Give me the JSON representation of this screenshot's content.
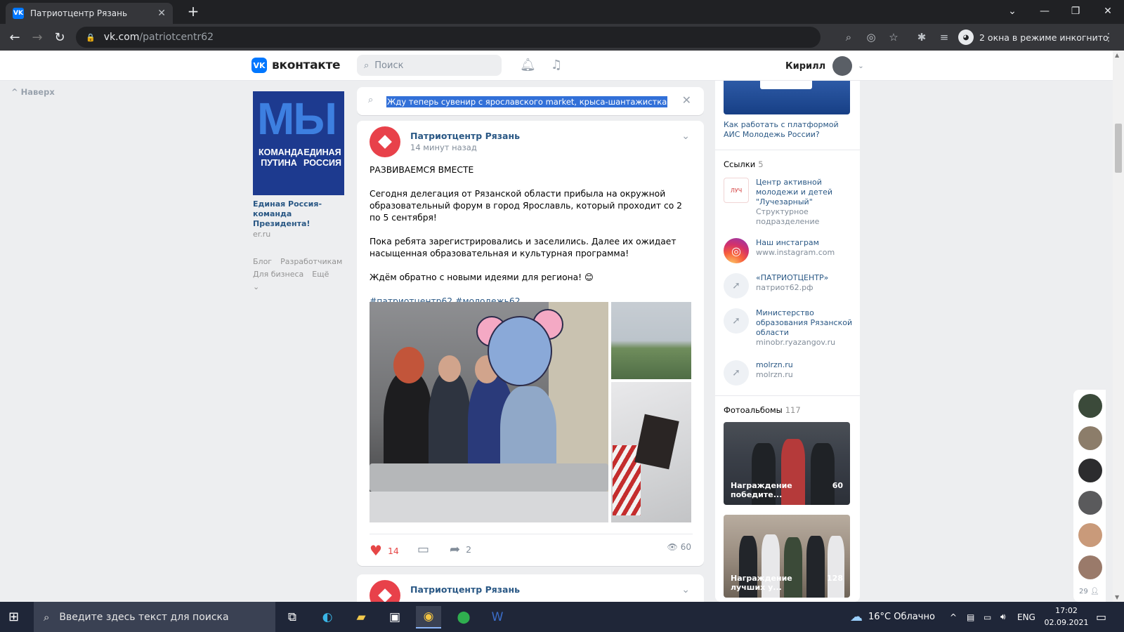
{
  "browser": {
    "tab_title": "Патриотцентр Рязань",
    "tab_favicon": "vk-icon",
    "url_domain": "vk.com",
    "url_path": "/patriotcentr62",
    "incognito_label": "2 окна в режиме инкогнито"
  },
  "vk_header": {
    "logo_text": "вконтакте",
    "search_placeholder": "Поиск",
    "user_name": "Кирилл"
  },
  "left": {
    "back_to_top": "Наверх",
    "ad": {
      "image_big": "МЫ",
      "image_left": "КОМАНДА ПУТИНА",
      "image_right": "ЕДИНАЯ РОССИЯ",
      "title": "Единая Россия-команда Президента!",
      "domain": "er.ru"
    },
    "footer_links": [
      "Блог",
      "Разработчикам",
      "Для бизнеса",
      "Ещё ⌄"
    ]
  },
  "wall_search": {
    "query": "Жду теперь сувенир с ярославского market, крыса-шантажистка"
  },
  "post": {
    "author": "Патриотцентр Рязань",
    "time": "14 минут назад",
    "paragraphs": [
      "РАЗВИВАЕМСЯ ВМЕСТЕ",
      "Сегодня делегация от Рязанской области прибыла на окружной образовательный форум в город Ярославль, который проходит со 2 по 5 сентября!",
      "Пока ребята зарегистрировались и заселились. Далее их ожидает насыщенная образовательная и культурная программа!",
      "Ждём обратно с новыми идеями для региона! 😊"
    ],
    "hashtags": "#патриотцентр62 #молодежь62",
    "likes": "14",
    "shares": "2",
    "views": "60"
  },
  "post2": {
    "author": "Патриотцентр Рязань"
  },
  "right": {
    "ais_caption": "Как работать с платформой АИС Молодежь России?",
    "links_header": "Ссылки",
    "links_count": "5",
    "links": [
      {
        "title": "Центр активной молодежи и детей \"Лучезарный\"",
        "sub": "Структурное подразделение",
        "icon": "luchezarny-logo"
      },
      {
        "title": "Наш инстаграм",
        "sub": "www.instagram.com",
        "icon": "instagram-icon"
      },
      {
        "title": "«ПАТРИОТЦЕНТР»",
        "sub": "патриот62.рф",
        "icon": "link-arrow-icon"
      },
      {
        "title": "Министерство образования Рязанской области",
        "sub": "minobr.ryazangov.ru",
        "icon": "link-arrow-icon"
      },
      {
        "title": "molrzn.ru",
        "sub": "molrzn.ru",
        "icon": "link-arrow-icon"
      }
    ],
    "albums_header": "Фотоальбомы",
    "albums_count": "117",
    "albums": [
      {
        "title": "Награждение победите...",
        "count": "60"
      },
      {
        "title": "Награждение лучших у...",
        "count": "128"
      }
    ]
  },
  "friends_count": "29",
  "taskbar": {
    "search_placeholder": "Введите здесь текст для поиска",
    "weather": "16°C Облачно",
    "lang": "ENG",
    "time": "17:02",
    "date": "02.09.2021"
  }
}
